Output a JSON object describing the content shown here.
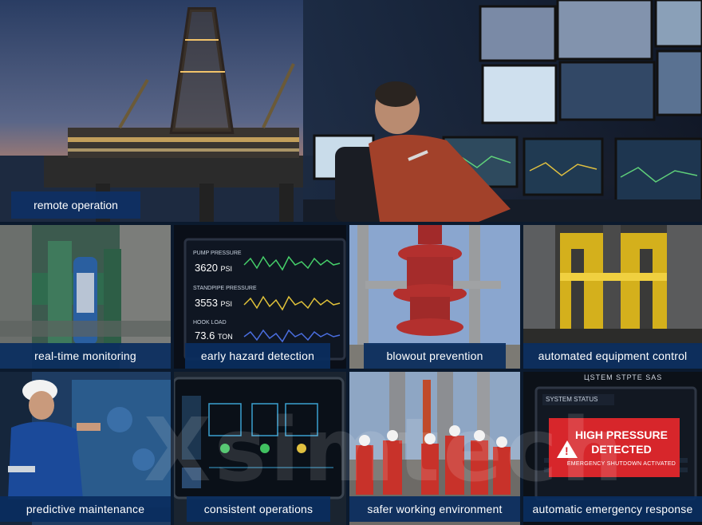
{
  "hero": {
    "caption": "remote operation"
  },
  "tiles": [
    {
      "caption": "real-time monitoring"
    },
    {
      "caption": "early hazard detection"
    },
    {
      "caption": "blowout prevention"
    },
    {
      "caption": "automated equipment control"
    },
    {
      "caption": "predictive maintenance"
    },
    {
      "caption": "consistent operations"
    },
    {
      "caption": "safer working environment"
    },
    {
      "caption": "automatic emergency response"
    }
  ],
  "readouts": [
    {
      "label": "PUMP PRESSURE",
      "value": "3620",
      "unit": "PSI"
    },
    {
      "label": "STANDPIPE PRESSURE",
      "value": "3553",
      "unit": "PSI"
    },
    {
      "label": "HOOK LOAD",
      "value": "73.6",
      "unit": "TON"
    }
  ],
  "alert": {
    "header": "SYSTEM STATUS",
    "title_line1": "HIGH PRESSURE",
    "title_line2": "DETECTED",
    "subtitle": "EMERGENCY SHUTDOWN ACTIVATED",
    "top_label": "ЦЅТЕМ ЅТРТЕ ЅАЅ"
  },
  "watermark": "Xsimtech",
  "colors": {
    "caption_bar": "#0e3064",
    "alarm": "#d7262b"
  }
}
